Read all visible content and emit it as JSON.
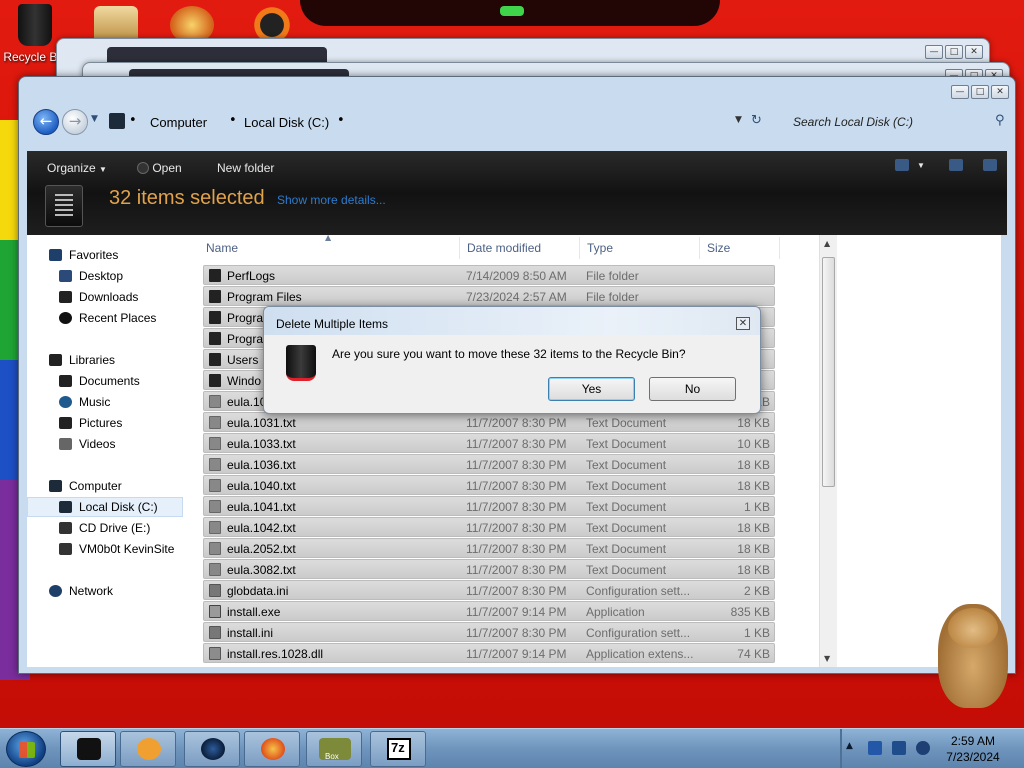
{
  "desktop": {
    "recycle_label": "Recycle Bin"
  },
  "explorer": {
    "breadcrumb": [
      "Computer",
      "Local Disk (C:)"
    ],
    "search_placeholder": "Search Local Disk (C:)",
    "toolbar": {
      "organize": "Organize",
      "open": "Open",
      "new_folder": "New folder"
    },
    "selection": {
      "count_text": "32 items selected",
      "details_link": "Show more details..."
    },
    "nav": {
      "favorites": "Favorites",
      "desktop": "Desktop",
      "downloads": "Downloads",
      "recent": "Recent Places",
      "libraries": "Libraries",
      "documents": "Documents",
      "music": "Music",
      "pictures": "Pictures",
      "videos": "Videos",
      "computer": "Computer",
      "local_disk": "Local Disk (C:)",
      "cd_drive": "CD Drive (E:)",
      "vm_share": "VM0b0t KevinSite",
      "network": "Network"
    },
    "columns": {
      "name": "Name",
      "date": "Date modified",
      "type": "Type",
      "size": "Size"
    },
    "files": [
      {
        "name": "PerfLogs",
        "date": "7/14/2009 8:50 AM",
        "type": "File folder",
        "size": "",
        "kind": "folder"
      },
      {
        "name": "Program Files",
        "date": "7/23/2024 2:57 AM",
        "type": "File folder",
        "size": "",
        "kind": "folder"
      },
      {
        "name": "Progra",
        "date": "",
        "type": "",
        "size": "",
        "kind": "folder"
      },
      {
        "name": "Progra",
        "date": "",
        "type": "",
        "size": "",
        "kind": "folder"
      },
      {
        "name": "Users",
        "date": "",
        "type": "",
        "size": "",
        "kind": "folder"
      },
      {
        "name": "Windo",
        "date": "",
        "type": "",
        "size": "",
        "kind": "folder"
      },
      {
        "name": "eula.10",
        "date": "",
        "type": "",
        "size": "KB",
        "kind": "txt"
      },
      {
        "name": "eula.1031.txt",
        "date": "11/7/2007 8:30 PM",
        "type": "Text Document",
        "size": "18 KB",
        "kind": "txt"
      },
      {
        "name": "eula.1033.txt",
        "date": "11/7/2007 8:30 PM",
        "type": "Text Document",
        "size": "10 KB",
        "kind": "txt"
      },
      {
        "name": "eula.1036.txt",
        "date": "11/7/2007 8:30 PM",
        "type": "Text Document",
        "size": "18 KB",
        "kind": "txt"
      },
      {
        "name": "eula.1040.txt",
        "date": "11/7/2007 8:30 PM",
        "type": "Text Document",
        "size": "18 KB",
        "kind": "txt"
      },
      {
        "name": "eula.1041.txt",
        "date": "11/7/2007 8:30 PM",
        "type": "Text Document",
        "size": "1 KB",
        "kind": "txt"
      },
      {
        "name": "eula.1042.txt",
        "date": "11/7/2007 8:30 PM",
        "type": "Text Document",
        "size": "18 KB",
        "kind": "txt"
      },
      {
        "name": "eula.2052.txt",
        "date": "11/7/2007 8:30 PM",
        "type": "Text Document",
        "size": "18 KB",
        "kind": "txt"
      },
      {
        "name": "eula.3082.txt",
        "date": "11/7/2007 8:30 PM",
        "type": "Text Document",
        "size": "18 KB",
        "kind": "txt"
      },
      {
        "name": "globdata.ini",
        "date": "11/7/2007 8:30 PM",
        "type": "Configuration sett...",
        "size": "2 KB",
        "kind": "ini"
      },
      {
        "name": "install.exe",
        "date": "11/7/2007 9:14 PM",
        "type": "Application",
        "size": "835 KB",
        "kind": "exe"
      },
      {
        "name": "install.ini",
        "date": "11/7/2007 8:30 PM",
        "type": "Configuration sett...",
        "size": "1 KB",
        "kind": "ini"
      },
      {
        "name": "install.res.1028.dll",
        "date": "11/7/2007 9:14 PM",
        "type": "Application extens...",
        "size": "74 KB",
        "kind": "dll"
      }
    ]
  },
  "dialog": {
    "title": "Delete Multiple Items",
    "message": "Are you sure you want to move these 32 items to the Recycle Bin?",
    "yes": "Yes",
    "no": "No",
    "close_glyph": "✕"
  },
  "taskbar": {
    "time": "2:59 AM",
    "date": "7/23/2024",
    "box_label": "Box",
    "sevenzip_label": "7z"
  },
  "colors": {
    "selection_text": "#e0a24a",
    "details_link": "#2c7bd0",
    "desktop_red": "#e21b10"
  }
}
